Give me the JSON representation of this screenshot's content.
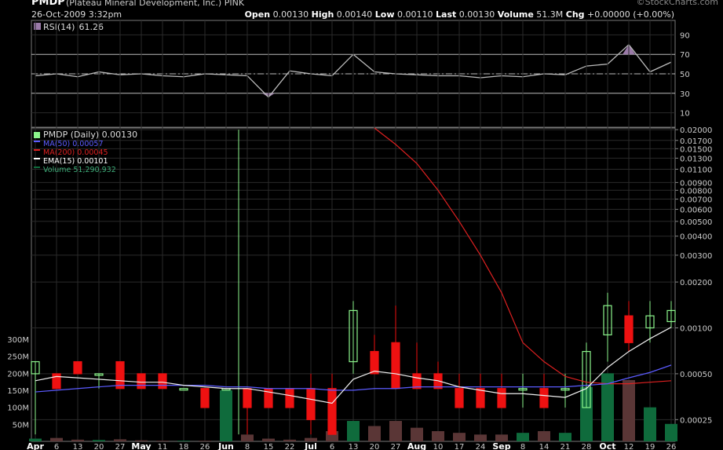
{
  "header": {
    "ticker": "PMDP",
    "company": "(Plateau Mineral Development, Inc.)",
    "exchange": "PINK",
    "datetime": "26-Oct-2009 3:32pm",
    "open_label": "Open",
    "open": "0.00130",
    "high_label": "High",
    "high": "0.00140",
    "low_label": "Low",
    "low": "0.00110",
    "last_label": "Last",
    "last": "0.00130",
    "volume_label": "Volume",
    "volume": "51.3M",
    "chg_label": "Chg",
    "chg": "+0.00000 (+0.00%)",
    "brand": "©StockCharts.com"
  },
  "colors": {
    "background": "#000000",
    "grid": "#2a2a2a",
    "up_candle": "#8cf58c",
    "down_candle": "#ee1111",
    "ma50": "#5b5bff",
    "ma200": "#dd2020",
    "ema15": "#eeeeee",
    "volume_up": "#0f6b3c",
    "volume_down": "#5a3636",
    "rsi_line": "#bbbbbb",
    "rsi_fill": "#9a7aa8"
  },
  "chart_data": {
    "type": "line",
    "x_tick_labels": [
      "Apr",
      "6",
      "13",
      "20",
      "27",
      "May",
      "11",
      "18",
      "26",
      "Jun",
      "8",
      "15",
      "22",
      "Jul",
      "6",
      "13",
      "20",
      "27",
      "Aug",
      "10",
      "17",
      "24",
      "Sep",
      "8",
      "14",
      "21",
      "28",
      "Oct",
      "12",
      "19",
      "26"
    ],
    "rsi_panel": {
      "label": "RSI(14)",
      "value": "61.26",
      "y_ticks": [
        "90",
        "70",
        "50",
        "30",
        "10"
      ],
      "ylim": [
        0,
        100
      ],
      "x": [
        "Apr 1",
        "Apr 6",
        "Apr 13",
        "Apr 20",
        "Apr 27",
        "May 4",
        "May 11",
        "May 18",
        "May 26",
        "Jun 1",
        "Jun 8",
        "Jun 15",
        "Jun 22",
        "Jul 1",
        "Jul 6",
        "Jul 13",
        "Jul 20",
        "Jul 27",
        "Aug 3",
        "Aug 10",
        "Aug 17",
        "Aug 24",
        "Aug 31",
        "Sep 8",
        "Sep 14",
        "Sep 21",
        "Sep 28",
        "Oct 5",
        "Oct 12",
        "Oct 19",
        "Oct 26"
      ],
      "values": [
        48,
        50,
        47,
        52,
        49,
        50,
        48,
        47,
        50,
        49,
        48,
        26,
        53,
        50,
        48,
        70,
        52,
        50,
        49,
        48,
        48,
        46,
        48,
        47,
        50,
        49,
        58,
        60,
        80,
        52,
        62
      ]
    },
    "price_panel": {
      "legend": [
        {
          "label": "PMDP (Daily) 0.00130"
        },
        {
          "label": "MA(50) 0.00057"
        },
        {
          "label": "MA(200) 0.00045"
        },
        {
          "label": "EMA(15) 0.00101"
        },
        {
          "label": "Volume 51,290,932"
        }
      ],
      "y_scale": "log",
      "y_ticks": [
        "0.02000",
        "0.01700",
        "0.01500",
        "0.01300",
        "0.01100",
        "0.00900",
        "0.00800",
        "0.00700",
        "0.00600",
        "0.00500",
        "0.00400",
        "0.00300",
        "0.00200",
        "0.00100",
        "0.00050",
        "0.00025"
      ],
      "ylim": [
        0.00018,
        0.0205
      ],
      "volume_ticks": [
        "300M",
        "250M",
        "200M",
        "150M",
        "100M",
        "50M"
      ],
      "volume_ylim": [
        0,
        300000000
      ],
      "spike": {
        "x": "Jun 2",
        "high": 0.02,
        "low": 0.0002
      },
      "x": [
        "Apr 1",
        "Apr 6",
        "Apr 13",
        "Apr 20",
        "Apr 27",
        "May 4",
        "May 11",
        "May 18",
        "May 26",
        "Jun 1",
        "Jun 8",
        "Jun 15",
        "Jun 22",
        "Jul 1",
        "Jul 6",
        "Jul 13",
        "Jul 20",
        "Jul 27",
        "Aug 3",
        "Aug 10",
        "Aug 17",
        "Aug 24",
        "Aug 31",
        "Sep 8",
        "Sep 14",
        "Sep 21",
        "Sep 28",
        "Oct 5",
        "Oct 12",
        "Oct 19",
        "Oct 26"
      ],
      "series": [
        {
          "name": "PMDP (Daily)",
          "candles": [
            {
              "o": 0.0005,
              "h": 0.0006,
              "l": 0.0002,
              "c": 0.0006
            },
            {
              "o": 0.0005,
              "h": 0.0005,
              "l": 0.0004,
              "c": 0.0004
            },
            {
              "o": 0.0006,
              "h": 0.0006,
              "l": 0.0005,
              "c": 0.0005
            },
            {
              "o": 0.0005,
              "h": 0.0005,
              "l": 0.0004,
              "c": 0.0005
            },
            {
              "o": 0.0006,
              "h": 0.0006,
              "l": 0.0004,
              "c": 0.0004
            },
            {
              "o": 0.0005,
              "h": 0.0005,
              "l": 0.0004,
              "c": 0.0004
            },
            {
              "o": 0.0005,
              "h": 0.0005,
              "l": 0.0004,
              "c": 0.0004
            },
            {
              "o": 0.0004,
              "h": 0.0004,
              "l": 0.0004,
              "c": 0.0004
            },
            {
              "o": 0.0004,
              "h": 0.0004,
              "l": 0.0003,
              "c": 0.0003
            },
            {
              "o": 0.0004,
              "h": 0.0004,
              "l": 0.0004,
              "c": 0.0004
            },
            {
              "o": 0.0004,
              "h": 0.0004,
              "l": 0.0002,
              "c": 0.0003
            },
            {
              "o": 0.0004,
              "h": 0.0004,
              "l": 0.0003,
              "c": 0.0003
            },
            {
              "o": 0.0004,
              "h": 0.0004,
              "l": 0.0003,
              "c": 0.0003
            },
            {
              "o": 0.0004,
              "h": 0.0005,
              "l": 0.0002,
              "c": 0.00025
            },
            {
              "o": 0.0004,
              "h": 0.0005,
              "l": 0.0002,
              "c": 0.0002
            },
            {
              "o": 0.0006,
              "h": 0.0015,
              "l": 0.0005,
              "c": 0.0013
            },
            {
              "o": 0.0007,
              "h": 0.0009,
              "l": 0.0005,
              "c": 0.0005
            },
            {
              "o": 0.0008,
              "h": 0.0014,
              "l": 0.0004,
              "c": 0.0004
            },
            {
              "o": 0.0005,
              "h": 0.0008,
              "l": 0.0004,
              "c": 0.0004
            },
            {
              "o": 0.0005,
              "h": 0.0006,
              "l": 0.0004,
              "c": 0.0004
            },
            {
              "o": 0.0004,
              "h": 0.0005,
              "l": 0.0003,
              "c": 0.0003
            },
            {
              "o": 0.0004,
              "h": 0.0005,
              "l": 0.0003,
              "c": 0.0003
            },
            {
              "o": 0.0004,
              "h": 0.0005,
              "l": 0.0003,
              "c": 0.0003
            },
            {
              "o": 0.0004,
              "h": 0.0005,
              "l": 0.0003,
              "c": 0.0004
            },
            {
              "o": 0.0004,
              "h": 0.0005,
              "l": 0.0003,
              "c": 0.0003
            },
            {
              "o": 0.0004,
              "h": 0.0005,
              "l": 0.0003,
              "c": 0.0004
            },
            {
              "o": 0.0003,
              "h": 0.0008,
              "l": 0.0003,
              "c": 0.0007
            },
            {
              "o": 0.0009,
              "h": 0.0017,
              "l": 0.0006,
              "c": 0.0014
            },
            {
              "o": 0.0012,
              "h": 0.0015,
              "l": 0.0007,
              "c": 0.0008
            },
            {
              "o": 0.001,
              "h": 0.0015,
              "l": 0.0008,
              "c": 0.0012
            },
            {
              "o": 0.0011,
              "h": 0.0015,
              "l": 0.001,
              "c": 0.0013
            }
          ]
        },
        {
          "name": "MA(50)",
          "values": [
            0.00038,
            0.00039,
            0.0004,
            0.00041,
            0.00042,
            0.00042,
            0.00042,
            0.00042,
            0.00042,
            0.00041,
            0.00041,
            0.0004,
            0.0004,
            0.0004,
            0.00039,
            0.00039,
            0.0004,
            0.0004,
            0.00041,
            0.00041,
            0.00041,
            0.00041,
            0.00041,
            0.00041,
            0.00041,
            0.00041,
            0.00042,
            0.00043,
            0.00047,
            0.00051,
            0.00057
          ]
        },
        {
          "name": "MA(200)",
          "values": [
            null,
            null,
            null,
            null,
            null,
            null,
            null,
            null,
            null,
            null,
            null,
            null,
            null,
            null,
            null,
            null,
            0.0205,
            0.016,
            0.012,
            0.008,
            0.005,
            0.003,
            0.0017,
            0.0008,
            0.0006,
            0.00048,
            0.00044,
            0.00043,
            0.00043,
            0.00044,
            0.00045
          ]
        },
        {
          "name": "EMA(15)",
          "values": [
            0.00045,
            0.00048,
            0.00047,
            0.00046,
            0.00045,
            0.00044,
            0.00044,
            0.00042,
            0.00041,
            0.0004,
            0.0004,
            0.00038,
            0.00036,
            0.00034,
            0.00032,
            0.00046,
            0.00052,
            0.0005,
            0.00047,
            0.00045,
            0.00041,
            0.00039,
            0.00037,
            0.00037,
            0.00036,
            0.00035,
            0.0004,
            0.00055,
            0.0007,
            0.00085,
            0.00101
          ]
        },
        {
          "name": "Volume",
          "values": [
            8000000,
            10000000,
            5000000,
            4000000,
            6000000,
            3000000,
            2000000,
            2000000,
            2000000,
            150000000,
            20000000,
            8000000,
            5000000,
            10000000,
            30000000,
            60000000,
            45000000,
            60000000,
            40000000,
            30000000,
            25000000,
            20000000,
            20000000,
            25000000,
            30000000,
            25000000,
            160000000,
            200000000,
            180000000,
            100000000,
            51290932
          ]
        }
      ]
    }
  }
}
